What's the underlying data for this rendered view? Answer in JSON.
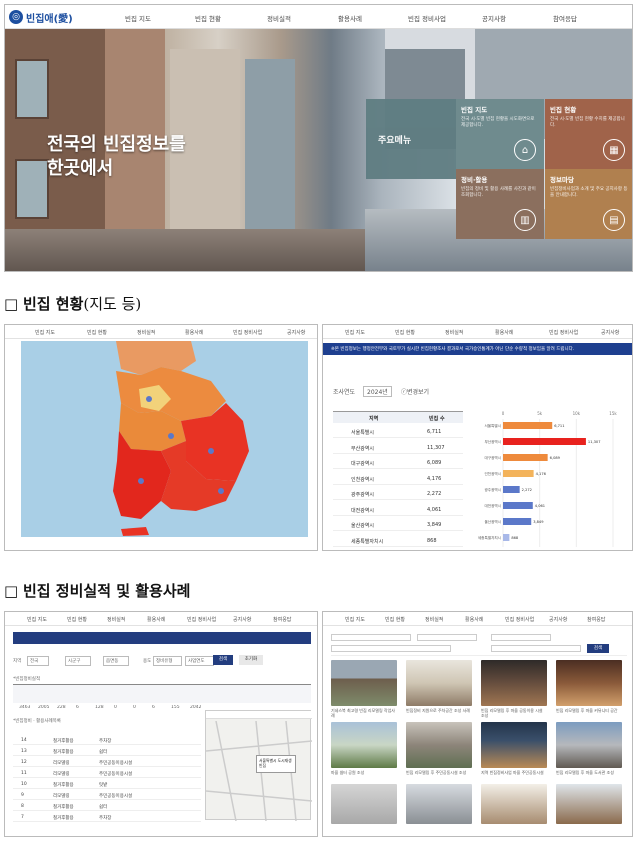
{
  "hero": {
    "logo_text": "빈집애(愛)",
    "nav": [
      "빈집 지도",
      "빈집 현황",
      "정비실적",
      "활용사례",
      "빈집 정비사업",
      "공지사항",
      "참여응답"
    ],
    "title_line1": "전국의 빈집정보를",
    "title_line2": "한곳에서",
    "main_menu_label": "주요메뉴",
    "menu_cards": [
      {
        "title": "빈집 지도",
        "desc": "전국 시·도별 빈집 현황을 시도화면으로 제공합니다.",
        "icon": "home-map-icon",
        "color": "#6f8b8e"
      },
      {
        "title": "빈집 현황",
        "desc": "전국 시·도별 빈집 현황 수치를 제공합니다.",
        "icon": "calculator-icon",
        "color": "#a0634a"
      },
      {
        "title": "정비·활용",
        "desc": "빈집의 정비 및 활용 사례를 사진과 같이 조회합니다.",
        "icon": "building-chart-icon",
        "color": "#8b6f5e"
      },
      {
        "title": "정보마당",
        "desc": "빈집정비사업과 소개 및 주요 공지사항 등을 안내합니다.",
        "icon": "document-search-icon",
        "color": "#b0804f"
      }
    ]
  },
  "section1": {
    "box": "□",
    "bold": "빈집 현황",
    "rest": "(지도 등)"
  },
  "section2": {
    "box": "□",
    "bold": "빈집 정비실적 및 활용사례"
  },
  "map_panel": {
    "nav": [
      "빈집 지도",
      "빈집 현황",
      "정비실적",
      "활용사례",
      "빈집 정비사업",
      "공지사항"
    ]
  },
  "stats_panel": {
    "nav": [
      "빈집 지도",
      "빈집 현황",
      "정비실적",
      "활용사례",
      "빈집 정비사업",
      "공지사항"
    ],
    "banner": "※본 빈집정보는 행정안전부와 국토부가 실시한 빈집현황조사 결과로서 국가승인통계가 아닌 단순 수량적 정보임을 알려 드립니다.",
    "year_label": "조사연도",
    "year_value": "2024년",
    "refresh_label": "ⓡ변경보기",
    "header_region": "지역",
    "header_count": "빈집 수",
    "axis_ticks": [
      "0",
      "5k",
      "10k",
      "15k"
    ],
    "colors": {
      "high": "#e8221e",
      "mid": "#ee8a3c",
      "low": "#f3b35b",
      "blue1": "#5b78c9",
      "blue2": "#7c94d8",
      "blue3": "#a8b8e8"
    }
  },
  "chart_data": {
    "type": "bar",
    "categories": [
      "서울특별시",
      "부산광역시",
      "대구광역시",
      "인천광역시",
      "광주광역시",
      "대전광역시",
      "울산광역시",
      "세종특별자치시"
    ],
    "values": [
      6711,
      11307,
      6089,
      4176,
      2272,
      4061,
      3849,
      868
    ],
    "value_labels": [
      "6,711",
      "11,307",
      "6,089",
      "4,176",
      "2,272",
      "4,061",
      "3,849",
      "868"
    ],
    "xlim": [
      0,
      15000
    ]
  },
  "perf_panel": {
    "nav": [
      "빈집 지도",
      "빈집 현황",
      "정비실적",
      "활용사례",
      "빈집 정비사업",
      "공지사항",
      "참여응답"
    ],
    "filter_label": "지역",
    "filter_values": [
      "전국",
      "시군구",
      "읍면동"
    ],
    "type_label": "용도",
    "type_values": [
      "정비유형",
      "사업연도"
    ],
    "search_button": "검색",
    "reset_button": "초기화",
    "table_caption": "*빈집정비실적",
    "table2_caption": "*빈집정비 · 활용사례목록",
    "total_row": [
      "3463",
      "2005",
      "228",
      "6",
      "128",
      "0",
      "0",
      "6",
      "155",
      "2042"
    ],
    "rows": [
      [
        "14",
        "철거후활용",
        "주차장"
      ],
      [
        "13",
        "철거후활용",
        "쉼터"
      ],
      [
        "12",
        "리모델링",
        "주민공동이용시설"
      ],
      [
        "11",
        "리모델링",
        "주민공동이용시설"
      ],
      [
        "10",
        "철거후활용",
        "텃밭"
      ],
      [
        "9",
        "리모델링",
        "주민공동이용시설"
      ],
      [
        "8",
        "철거후활용",
        "쉼터"
      ],
      [
        "7",
        "철거후활용",
        "주차장"
      ]
    ],
    "map_popup": "서울특별시 도시재생 빈집"
  },
  "gallery_panel": {
    "nav": [
      "빈집 지도",
      "빈집 현황",
      "정비실적",
      "활용사례",
      "빈집 정비사업",
      "공지사항",
      "참여응답"
    ],
    "search_button": "검색",
    "captions": [
      "기네스북 최고령 빈집 리모델링 작업사례",
      "빈집정비 지원으로 주차공간 조성 사례",
      "빈집 리모델링 후 마을 공동이용 시설 조성",
      "빈집 리모델링 후 마을 커뮤니티 공간",
      "마을 쉼터 공원 조성",
      "빈집 리모델링 후 주민공동시설 조성",
      "지역 빈집정비사업 마을 주민공동시설",
      "빈집 리모델링 후 마을 도서관 조성"
    ]
  }
}
